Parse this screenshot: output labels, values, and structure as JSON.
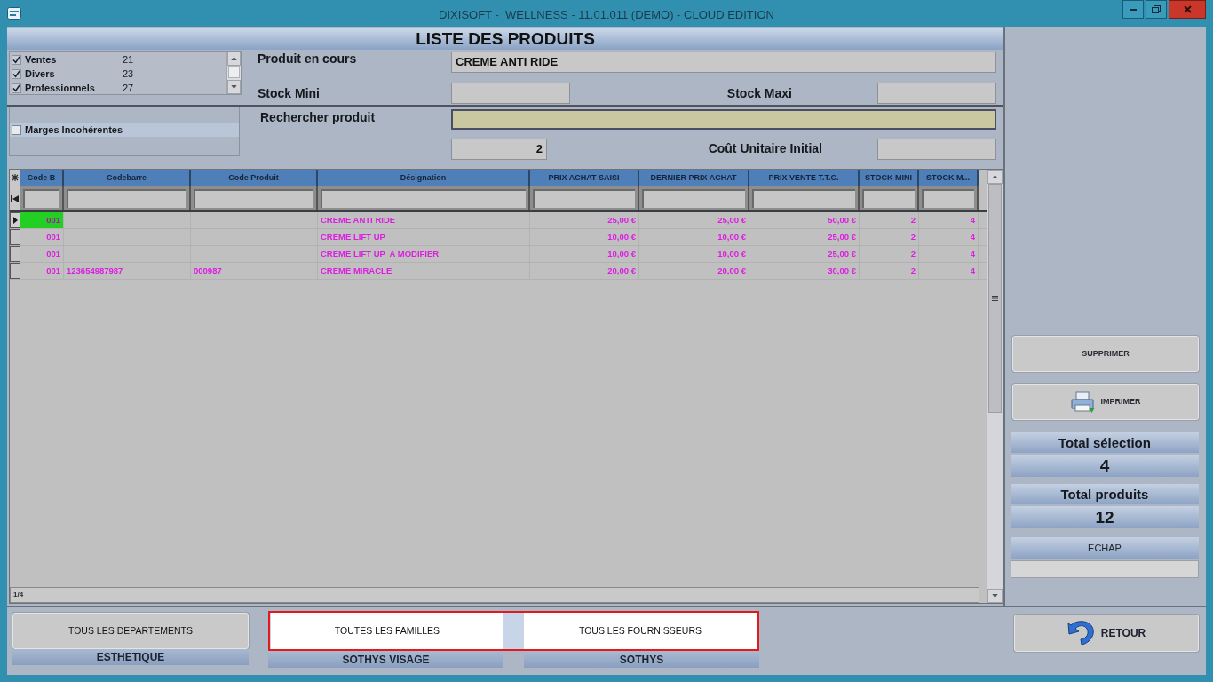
{
  "window": {
    "title": "DIXISOFT -  WELLNESS - 11.01.011 (DEMO) - CLOUD EDITION"
  },
  "heading": "LISTE DES PRODUITS",
  "categories": [
    {
      "label": "Ventes",
      "count": "21",
      "checked": true
    },
    {
      "label": "Divers",
      "count": "23",
      "checked": true
    },
    {
      "label": "Professionnels",
      "count": "27",
      "checked": true
    }
  ],
  "incoherent_margins": {
    "label": "Marges Incohérentes",
    "checked": false
  },
  "current_product": {
    "label": "Produit en cours",
    "value": "CREME ANTI RIDE"
  },
  "stock_min": {
    "label": "Stock Mini"
  },
  "stock_max": {
    "label": "Stock Maxi"
  },
  "product_search": {
    "label": "Rechercher produit"
  },
  "count_field": {
    "value": "2"
  },
  "initial_unit_cost": {
    "label": "Coût Unitaire Initial"
  },
  "table": {
    "columns": [
      "Code B",
      "Codebarre",
      "Code Produit",
      "Désignation",
      "PRIX ACHAT SAISI",
      "DERNIER PRIX ACHAT",
      "PRIX VENTE T.T.C.",
      "STOCK MINI",
      "STOCK M..."
    ],
    "rows": [
      {
        "selected": true,
        "code_b": "001",
        "designation": "CREME ANTI RIDE",
        "prix_achat_saisi": "25,00 €",
        "dernier_prix_achat": "25,00 €",
        "prix_vente_ttc": "50,00 €",
        "stock_mini": "2",
        "column_9": "4"
      },
      {
        "selected": false,
        "code_b": "001",
        "designation": "CREME LIFT UP",
        "prix_achat_saisi": "10,00 €",
        "dernier_prix_achat": "10,00 €",
        "prix_vente_ttc": "25,00 €",
        "stock_mini": "2",
        "column_9": "4"
      },
      {
        "selected": false,
        "code_b": "001",
        "designation": "CREME LIFT UP  A MODIFIER",
        "prix_achat_saisi": "10,00 €",
        "dernier_prix_achat": "10,00 €",
        "prix_vente_ttc": "25,00 €",
        "stock_mini": "2",
        "column_9": "4"
      },
      {
        "selected": false,
        "code_b": "001",
        "codebarre": "123654987987",
        "code_produit": "000987",
        "designation": "CREME MIRACLE",
        "prix_achat_saisi": "20,00 €",
        "dernier_prix_achat": "20,00 €",
        "prix_vente_ttc": "30,00 €",
        "stock_mini": "2",
        "column_9": "4"
      }
    ],
    "pager": "1/4"
  },
  "actions": [
    {
      "label": "SUPPRIMER",
      "kind": "delete"
    },
    {
      "label": "IMPRIMER",
      "kind": "print"
    }
  ],
  "totals": [
    {
      "label": "Total sélection",
      "value": "4"
    },
    {
      "label": "Total produits",
      "value": "12"
    }
  ],
  "escape": {
    "label": "ECHAP"
  },
  "filters": [
    {
      "button": "TOUS LES DEPARTEMENTS",
      "value": "ESTHETIQUE",
      "highlighted": false
    },
    {
      "button": "TOUTES LES FAMILLES",
      "value": "SOTHYS VISAGE",
      "highlighted": true
    },
    {
      "button": "TOUS LES FOURNISSEURS",
      "value": "SOTHYS",
      "highlighted": true
    }
  ],
  "back_button": {
    "label": "RETOUR"
  }
}
